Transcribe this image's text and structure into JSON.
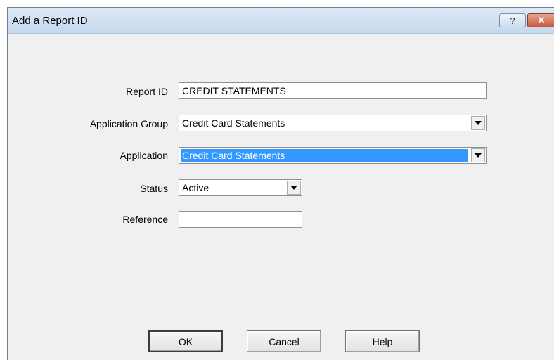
{
  "window": {
    "title": "Add a Report ID",
    "help_label": "?",
    "close_label": "✕"
  },
  "form": {
    "report_id": {
      "label": "Report ID",
      "value": "CREDIT STATEMENTS"
    },
    "application_group": {
      "label": "Application Group",
      "value": "Credit Card Statements"
    },
    "application": {
      "label": "Application",
      "value": "Credit Card Statements"
    },
    "status": {
      "label": "Status",
      "value": "Active"
    },
    "reference": {
      "label": "Reference",
      "value": ""
    }
  },
  "buttons": {
    "ok": "OK",
    "cancel": "Cancel",
    "help": "Help"
  },
  "colors": {
    "selection": "#3399ff",
    "titlebar": "#c5d8ee",
    "close_button": "#c75a3f"
  }
}
